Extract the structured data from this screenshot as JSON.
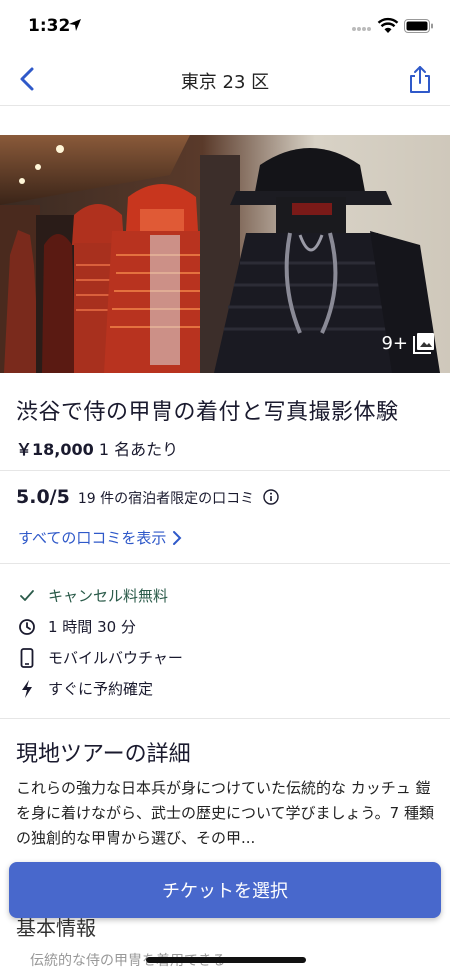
{
  "status_bar": {
    "time": "1:32"
  },
  "nav": {
    "title": "東京 23 区",
    "back_icon": "chevron-left-icon",
    "share_icon": "share-icon"
  },
  "hero": {
    "photo_count": "9+"
  },
  "experience": {
    "title": "渋谷で侍の甲冑の着付と写真撮影体験",
    "price": "￥18,000",
    "price_unit": "1 名あたり"
  },
  "rating": {
    "score": "5.0/5",
    "description": "19 件の宿泊者限定の口コミ",
    "reviews_link": "すべての口コミを表示"
  },
  "features": [
    {
      "icon": "checkmark-icon",
      "label": "キャンセル料無料"
    },
    {
      "icon": "clock-icon",
      "label": "1 時間 30 分"
    },
    {
      "icon": "mobile-icon",
      "label": "モバイルバウチャー"
    },
    {
      "icon": "lightning-icon",
      "label": "すぐに予約確定"
    }
  ],
  "details": {
    "title": "現地ツアーの詳細",
    "text": "これらの強力な日本兵が身につけていた伝統的な カッチュ 鎧を身に着けながら、武士の歴史について学びましょう。7 種類の独創的な甲冑から選び、その甲..."
  },
  "basic_info": {
    "title": "基本情報",
    "first_item": "伝統的な侍の甲冑を着用できる"
  },
  "cta": {
    "label": "チケットを選択"
  },
  "colors": {
    "accent": "#2f59c9",
    "cta_bg": "#4868cc",
    "text": "#1a1a2e"
  }
}
